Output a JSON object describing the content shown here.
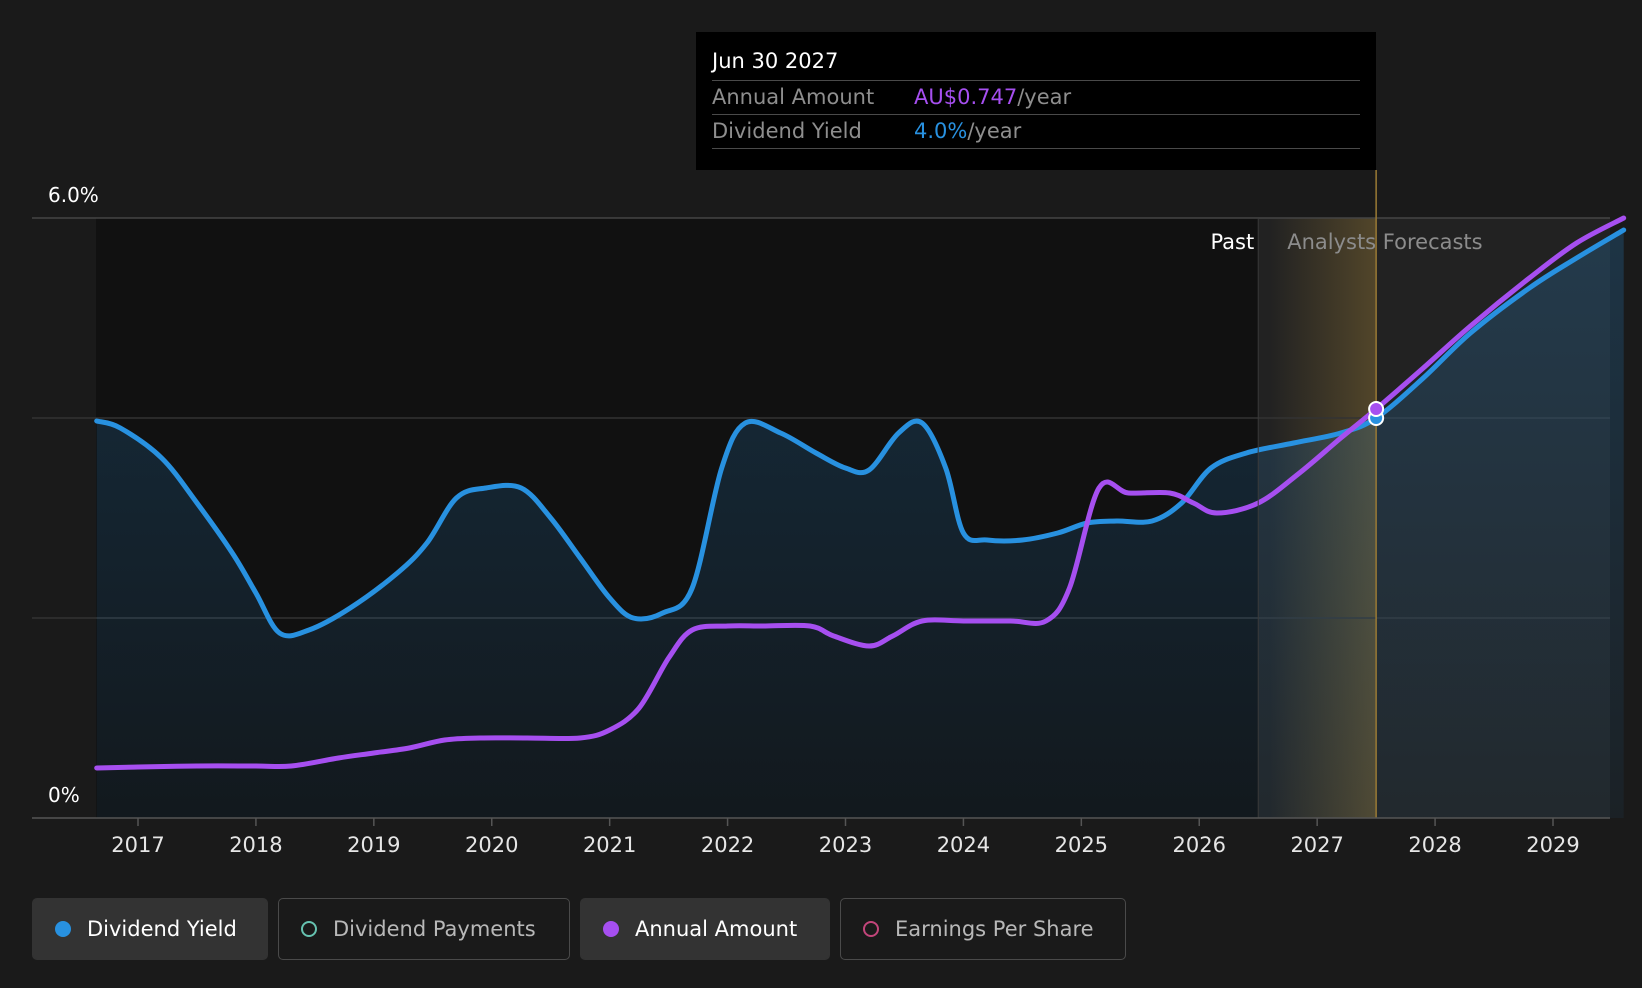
{
  "chart_data": {
    "type": "line",
    "y_axis": {
      "ticks": [
        "6.0%",
        "0%"
      ],
      "ylim": [
        0,
        6.0
      ],
      "gridlines": [
        6.0,
        4.0,
        2.0
      ]
    },
    "x_axis": {
      "ticks": [
        "2017",
        "2018",
        "2019",
        "2020",
        "2021",
        "2022",
        "2023",
        "2024",
        "2025",
        "2026",
        "2027",
        "2028",
        "2029"
      ],
      "xlim": [
        2016.3,
        2029.6
      ]
    },
    "regions": {
      "past_label": "Past",
      "forecast_label": "Analysts Forecasts",
      "divider_x": 2026.5,
      "forecast_highlight_end": 2027.5
    },
    "colors": {
      "yield": "#2891e0",
      "annual": "#a64ff0",
      "payments": "#66c2b0",
      "eps": "#c2457a"
    },
    "series": [
      {
        "name": "Dividend Yield",
        "color": "#2891e0",
        "points": [
          [
            2016.65,
            3.97
          ],
          [
            2016.85,
            3.9
          ],
          [
            2017.2,
            3.6
          ],
          [
            2017.5,
            3.15
          ],
          [
            2017.8,
            2.65
          ],
          [
            2018.0,
            2.25
          ],
          [
            2018.2,
            1.85
          ],
          [
            2018.45,
            1.88
          ],
          [
            2018.8,
            2.1
          ],
          [
            2019.2,
            2.45
          ],
          [
            2019.45,
            2.75
          ],
          [
            2019.7,
            3.2
          ],
          [
            2019.95,
            3.3
          ],
          [
            2020.25,
            3.3
          ],
          [
            2020.5,
            3.0
          ],
          [
            2020.75,
            2.6
          ],
          [
            2021.0,
            2.2
          ],
          [
            2021.2,
            2.0
          ],
          [
            2021.45,
            2.05
          ],
          [
            2021.7,
            2.3
          ],
          [
            2021.95,
            3.5
          ],
          [
            2022.15,
            3.95
          ],
          [
            2022.45,
            3.85
          ],
          [
            2022.75,
            3.65
          ],
          [
            2023.0,
            3.5
          ],
          [
            2023.2,
            3.48
          ],
          [
            2023.45,
            3.85
          ],
          [
            2023.65,
            3.95
          ],
          [
            2023.85,
            3.5
          ],
          [
            2024.0,
            2.85
          ],
          [
            2024.2,
            2.78
          ],
          [
            2024.5,
            2.78
          ],
          [
            2024.8,
            2.85
          ],
          [
            2025.05,
            2.95
          ],
          [
            2025.3,
            2.97
          ],
          [
            2025.6,
            2.97
          ],
          [
            2025.85,
            3.15
          ],
          [
            2026.1,
            3.5
          ],
          [
            2026.4,
            3.65
          ],
          [
            2026.8,
            3.75
          ],
          [
            2027.2,
            3.85
          ],
          [
            2027.5,
            4.0
          ],
          [
            2027.9,
            4.4
          ],
          [
            2028.3,
            4.85
          ],
          [
            2028.8,
            5.3
          ],
          [
            2029.2,
            5.6
          ],
          [
            2029.6,
            5.88
          ]
        ]
      },
      {
        "name": "Annual Amount",
        "color": "#a64ff0",
        "points": [
          [
            2016.65,
            0.5
          ],
          [
            2017.0,
            0.51
          ],
          [
            2017.5,
            0.52
          ],
          [
            2018.0,
            0.52
          ],
          [
            2018.3,
            0.52
          ],
          [
            2018.7,
            0.6
          ],
          [
            2019.0,
            0.65
          ],
          [
            2019.3,
            0.7
          ],
          [
            2019.6,
            0.78
          ],
          [
            2019.9,
            0.8
          ],
          [
            2020.3,
            0.8
          ],
          [
            2020.75,
            0.8
          ],
          [
            2021.0,
            0.88
          ],
          [
            2021.25,
            1.1
          ],
          [
            2021.5,
            1.6
          ],
          [
            2021.7,
            1.88
          ],
          [
            2022.0,
            1.92
          ],
          [
            2022.3,
            1.92
          ],
          [
            2022.7,
            1.92
          ],
          [
            2022.9,
            1.82
          ],
          [
            2023.2,
            1.72
          ],
          [
            2023.4,
            1.82
          ],
          [
            2023.65,
            1.97
          ],
          [
            2024.0,
            1.97
          ],
          [
            2024.4,
            1.97
          ],
          [
            2024.7,
            1.97
          ],
          [
            2024.9,
            2.3
          ],
          [
            2025.15,
            3.3
          ],
          [
            2025.4,
            3.25
          ],
          [
            2025.75,
            3.25
          ],
          [
            2025.95,
            3.15
          ],
          [
            2026.15,
            3.05
          ],
          [
            2026.5,
            3.15
          ],
          [
            2026.85,
            3.45
          ],
          [
            2027.2,
            3.8
          ],
          [
            2027.5,
            4.09
          ],
          [
            2027.9,
            4.5
          ],
          [
            2028.3,
            4.92
          ],
          [
            2028.8,
            5.4
          ],
          [
            2029.2,
            5.75
          ],
          [
            2029.6,
            6.0
          ]
        ]
      }
    ]
  },
  "tooltip": {
    "date": "Jun 30 2027",
    "rows": [
      {
        "label": "Annual Amount",
        "value": "AU$0.747",
        "unit": "/year",
        "color": "#a64ff0"
      },
      {
        "label": "Dividend Yield",
        "value": "4.0%",
        "unit": "/year",
        "color": "#2891e0"
      }
    ]
  },
  "legend": [
    {
      "label": "Dividend Yield",
      "color": "#2891e0",
      "active": true,
      "filled": true
    },
    {
      "label": "Dividend Payments",
      "color": "#66c2b0",
      "active": false,
      "filled": false
    },
    {
      "label": "Annual Amount",
      "color": "#a64ff0",
      "active": true,
      "filled": true
    },
    {
      "label": "Earnings Per Share",
      "color": "#c2457a",
      "active": false,
      "filled": false
    }
  ]
}
